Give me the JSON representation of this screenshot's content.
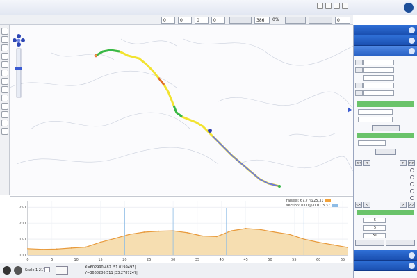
{
  "header": {
    "title": "",
    "subtitle": ""
  },
  "toolbar": {
    "fields": [
      "0",
      "0",
      "0",
      "0",
      "0",
      "0"
    ],
    "scale_value": "386",
    "scale_percent": "0%",
    "btn1": "",
    "btn2": "",
    "btn3": ""
  },
  "map": {
    "cities": [
      "",
      "",
      "",
      ""
    ],
    "villages": [
      "",
      "",
      "",
      "",
      ""
    ]
  },
  "profile": {
    "legend": [
      {
        "name": "raiseel: 67.77@25.31",
        "color": "#f2a23a"
      },
      {
        "name": "section: 0.00@-0.01 3.37",
        "color": "#8dbce6"
      }
    ],
    "y_ticks": [
      "100",
      "150",
      "200",
      "250"
    ],
    "x_ticks": [
      "0",
      "5",
      "10",
      "15",
      "20",
      "25",
      "30",
      "35",
      "40",
      "45",
      "50",
      "55",
      "60",
      "65"
    ]
  },
  "chart_data": {
    "type": "area",
    "x": [
      0,
      3,
      6,
      9,
      12,
      15,
      18,
      21,
      24,
      27,
      30,
      33,
      36,
      39,
      42,
      45,
      48,
      51,
      54,
      57,
      60,
      63,
      66
    ],
    "values": [
      120,
      118,
      119,
      122,
      125,
      140,
      152,
      165,
      172,
      175,
      176,
      170,
      160,
      158,
      176,
      183,
      180,
      172,
      165,
      150,
      140,
      132,
      124
    ],
    "ylim": [
      100,
      270
    ],
    "xlim": [
      0,
      66
    ],
    "grid": true,
    "legend_position": "top-right"
  },
  "status": {
    "scale_text": "Scale 1 2176",
    "coord_x": "X=602990.482 |51.0199497|",
    "coord_y": "Y=3668286.511 |33.2787247|"
  },
  "panel": {
    "sections": [
      "",
      "",
      "",
      "",
      ""
    ],
    "rows": [
      {
        "label": "",
        "value": "",
        "btn": ""
      },
      {
        "label": "",
        "value": "",
        "btn": ""
      },
      {
        "label": "",
        "value": "",
        "btn": ""
      },
      {
        "label": "",
        "value": "",
        "btn": ""
      },
      {
        "label": "",
        "value": "",
        "btn": ""
      }
    ],
    "route_text": "",
    "report_bar": "",
    "sel_label_1": "",
    "sel_label_2": "",
    "report_btn": "",
    "report_note": "",
    "profile_bar": "",
    "profile_label": "",
    "profile_btn": "",
    "nav_btns": [
      "<<",
      "<",
      ">",
      ">>"
    ],
    "radios": [
      "",
      "",
      "",
      "",
      ""
    ],
    "params_bar": "",
    "params": [
      {
        "label": "",
        "value": "5"
      },
      {
        "label": "",
        "value": "5"
      },
      {
        "label": "",
        "value": "50"
      }
    ],
    "footer_btns": [
      "",
      ""
    ]
  },
  "colors": {
    "panel_header": "#1a4fb0",
    "road_green": "#36b84a",
    "road_yellow": "#f2e330",
    "road_blue": "#6f7bd6",
    "profile_fill": "#f6deb1",
    "profile_line": "#e89a3c"
  }
}
